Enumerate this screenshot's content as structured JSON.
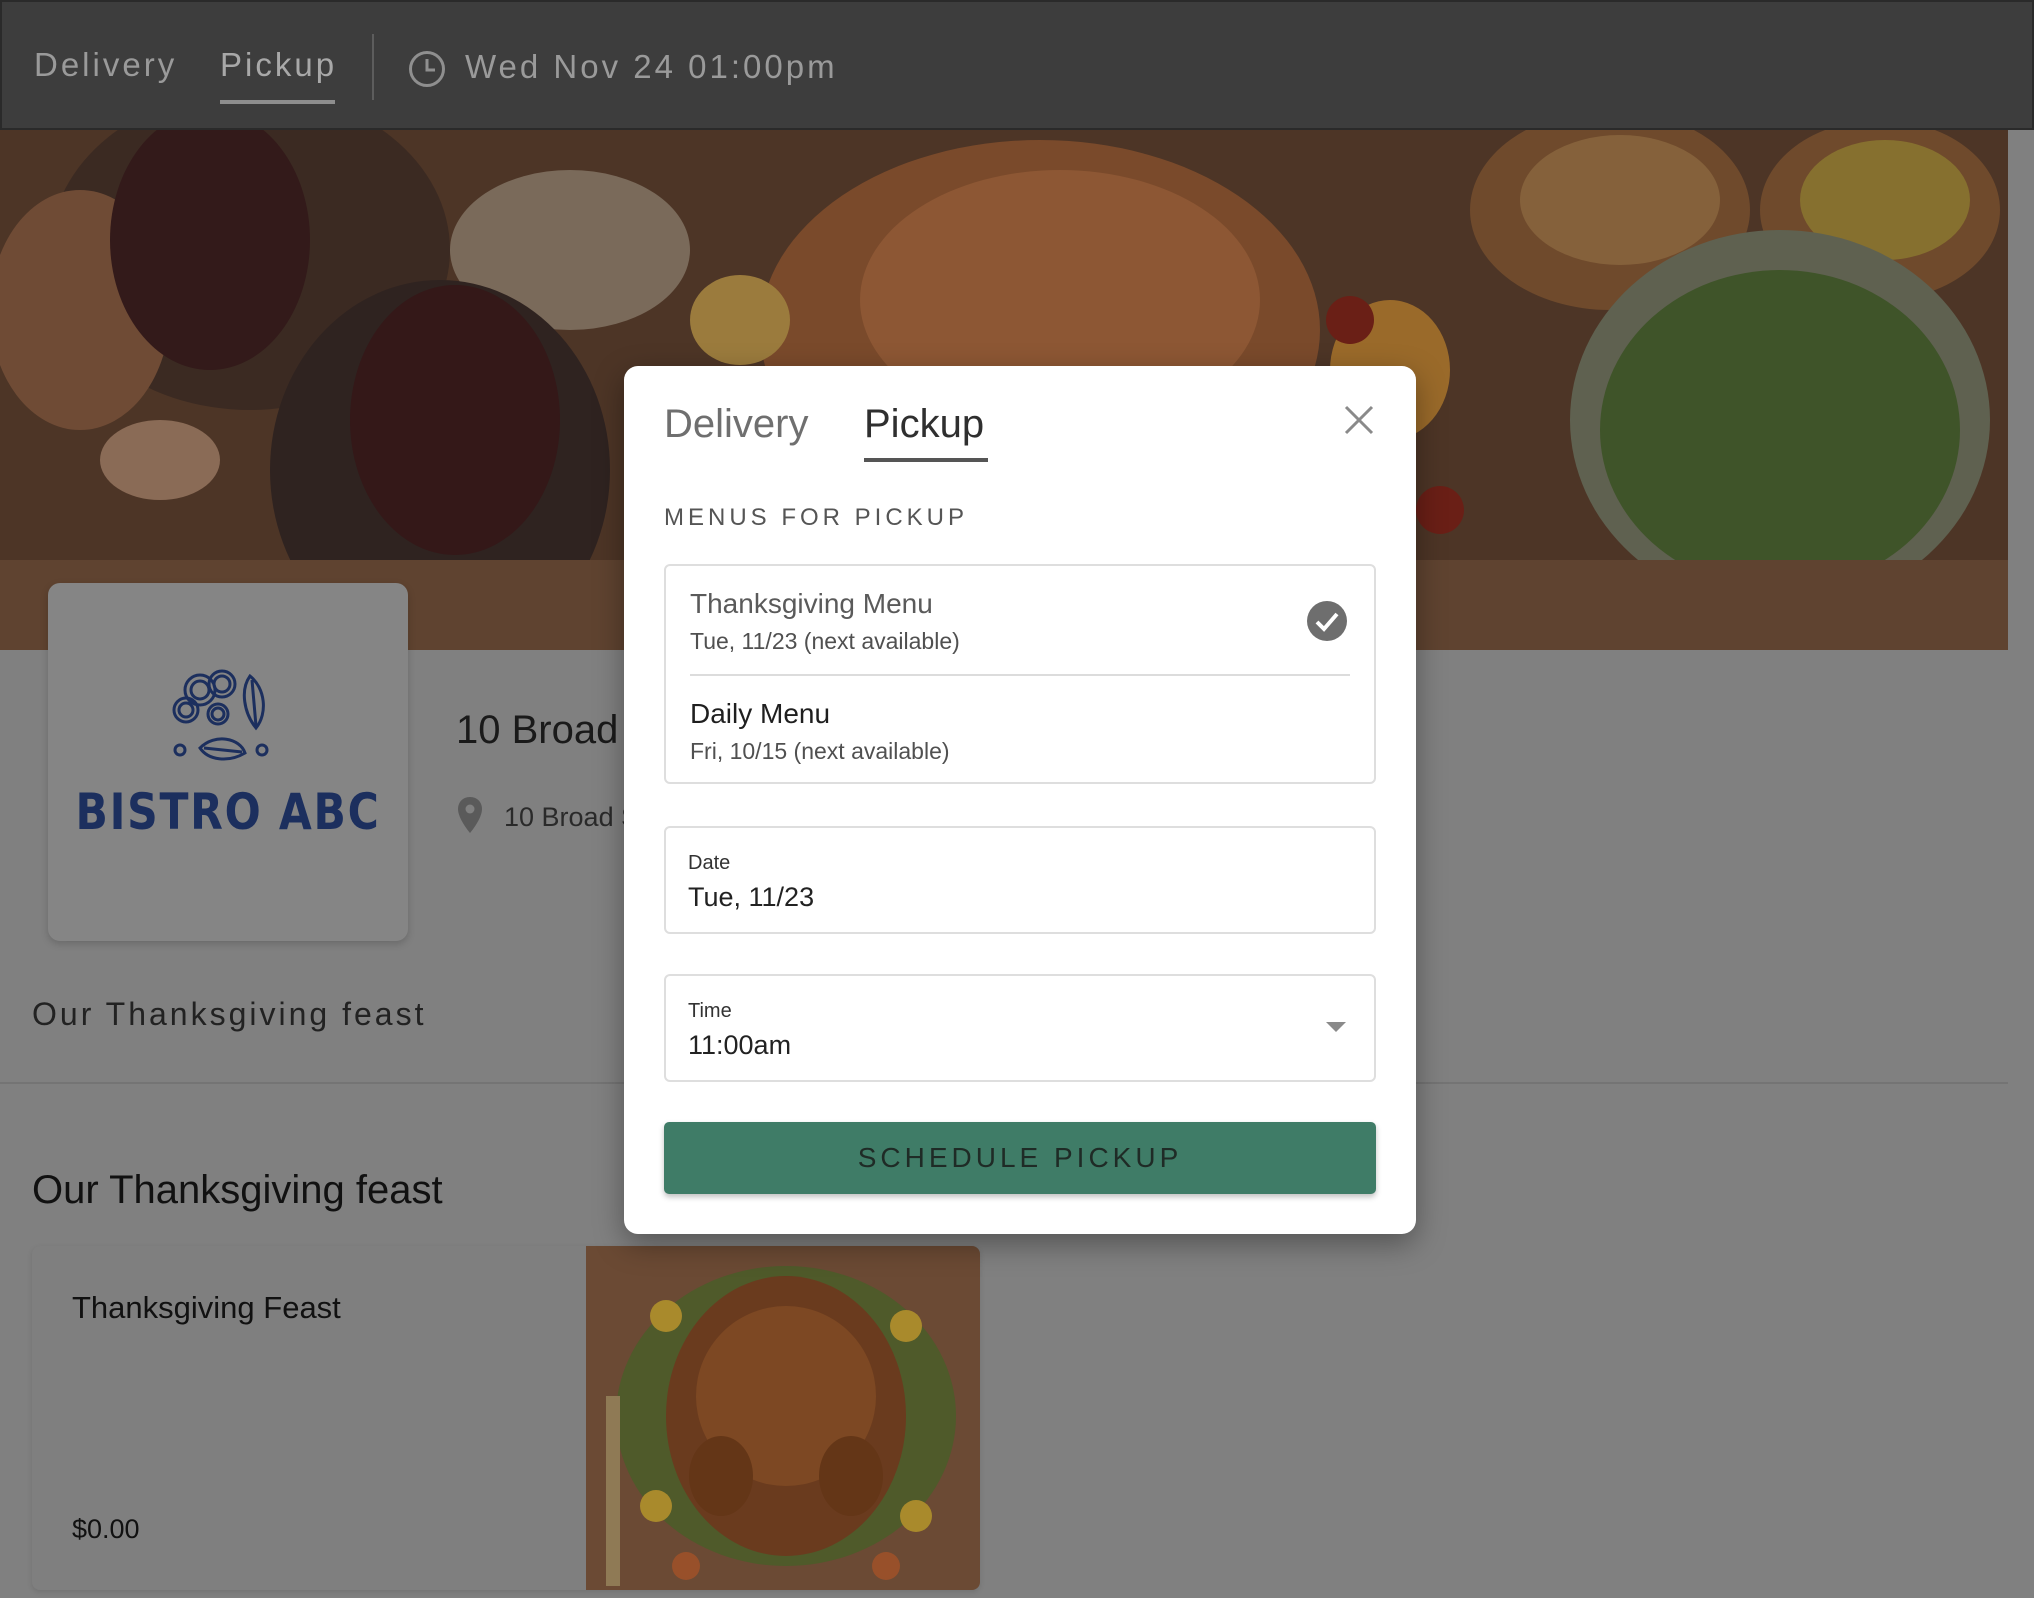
{
  "topbar": {
    "tabs": [
      {
        "label": "Delivery"
      },
      {
        "label": "Pickup"
      }
    ],
    "datetime": "Wed Nov 24 01:00pm"
  },
  "restaurant": {
    "logo_text": "BISTRO ABC",
    "name": "10 Broad",
    "address": "10 Broad S"
  },
  "section_tab": "Our Thanksgiving feast",
  "section_title": "Our Thanksgiving feast",
  "item": {
    "name": "Thanksgiving Feast",
    "price": "$0.00"
  },
  "modal": {
    "tabs": [
      {
        "label": "Delivery"
      },
      {
        "label": "Pickup"
      }
    ],
    "heading": "MENUS FOR PICKUP",
    "menus": [
      {
        "name": "Thanksgiving Menu",
        "availability": "Tue, 11/23 (next available)"
      },
      {
        "name": "Daily Menu",
        "availability": "Fri, 10/15 (next available)"
      }
    ],
    "date": {
      "label": "Date",
      "value": "Tue, 11/23"
    },
    "time": {
      "label": "Time",
      "value": "11:00am"
    },
    "submit_label": "SCHEDULE PICKUP"
  },
  "colors": {
    "overlay": "#808080",
    "topbar": "#3d3d3d",
    "button": "#3f7c67"
  }
}
